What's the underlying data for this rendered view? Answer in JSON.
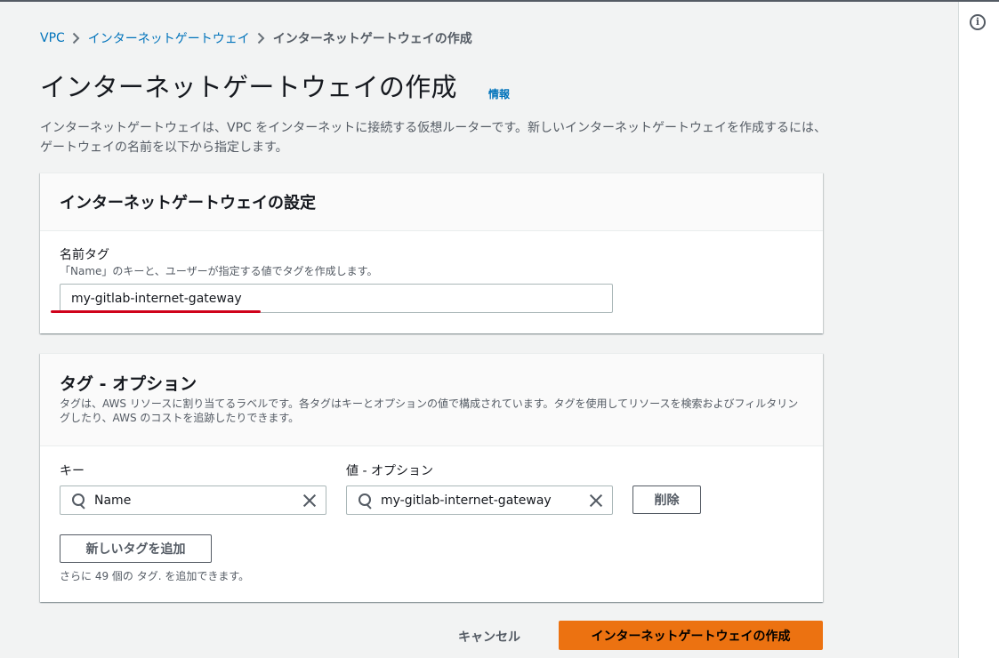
{
  "breadcrumb": {
    "items": [
      "VPC",
      "インターネットゲートウェイ"
    ],
    "current": "インターネットゲートウェイの作成"
  },
  "header": {
    "title": "インターネットゲートウェイの作成",
    "info_link": "情報",
    "description": "インターネットゲートウェイは、VPC をインターネットに接続する仮想ルーターです。新しいインターネットゲートウェイを作成するには、ゲートウェイの名前を以下から指定します。"
  },
  "settings": {
    "title": "インターネットゲートウェイの設定",
    "name_tag_label": "名前タグ",
    "name_tag_help": "「Name」のキーと、ユーザーが指定する値でタグを作成します。",
    "name_tag_value": "my-gitlab-internet-gateway"
  },
  "tags": {
    "title": "タグ - オプション",
    "description": "タグは、AWS リソースに割り当てるラベルです。各タグはキーとオプションの値で構成されています。タグを使用してリソースを検索およびフィルタリングしたり、AWS のコストを追跡したりできます。",
    "key_label": "キー",
    "value_label": "値 - オプション",
    "rows": [
      {
        "key": "Name",
        "value": "my-gitlab-internet-gateway"
      }
    ],
    "remove_button": "削除",
    "add_button": "新しいタグを追加",
    "remaining_text": "さらに 49 個の タグ. を追加できます。"
  },
  "footer": {
    "cancel": "キャンセル",
    "submit": "インターネットゲートウェイの作成"
  },
  "colors": {
    "link": "#0073bb",
    "primary": "#ec7211",
    "annotation": "#d0021b"
  },
  "icons": {
    "rail": "info-icon",
    "search": "search-icon",
    "clear": "close-icon",
    "separator": "chevron-right-icon"
  }
}
